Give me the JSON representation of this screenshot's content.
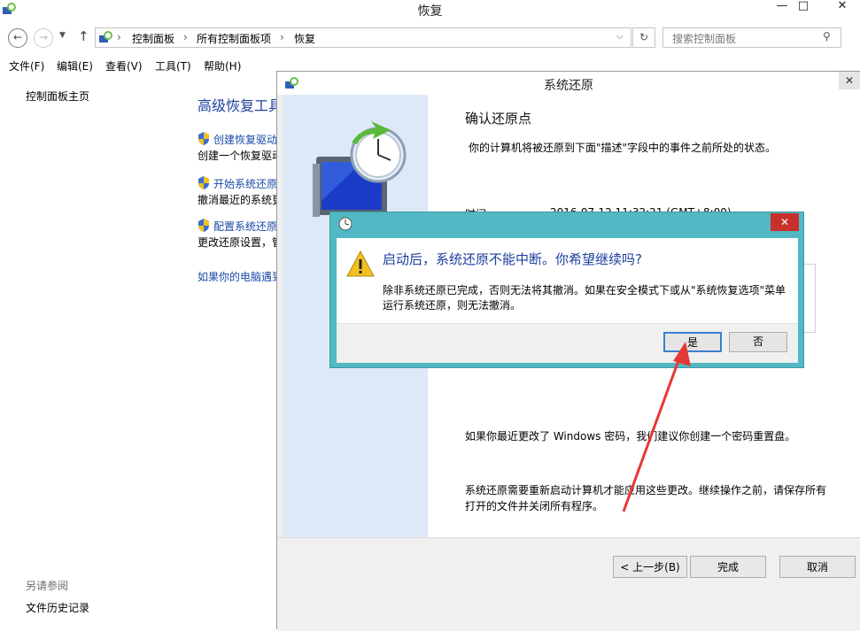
{
  "window": {
    "title": "恢复",
    "minimize": "—",
    "maximize": "□",
    "close": "✕"
  },
  "address": {
    "crumbs": [
      "控制面板",
      "所有控制面板项",
      "恢复"
    ],
    "search_placeholder": "搜索控制面板"
  },
  "menu": [
    "文件(F)",
    "编辑(E)",
    "查看(V)",
    "工具(T)",
    "帮助(H)"
  ],
  "left_pane": {
    "home_link": "控制面板主页",
    "see_also_label": "另请参阅",
    "file_history_link": "文件历史记录"
  },
  "main": {
    "heading": "高级恢复工具",
    "items": [
      {
        "link": "创建恢复驱动",
        "desc": "创建一个恢复驱动"
      },
      {
        "link": "开始系统还原",
        "desc": "撤消最近的系统更"
      },
      {
        "link": "配置系统还原",
        "desc": "更改还原设置，管"
      }
    ],
    "bottom_link": "如果你的电脑遇到"
  },
  "wizard": {
    "title": "系统还原",
    "heading": "确认还原点",
    "desc": "你的计算机将被还原到下面\"描述\"字段中的事件之前所处的状态。",
    "time_label": "时间:",
    "time_value": "2016-07-12 11:32:21 (GMT+8:00)",
    "password_note": "如果你最近更改了 Windows 密码，我们建议你创建一个密码重置盘。",
    "restart_note_1": "系统还原需要重新启动计算机才能应用这些更改。继续操作之前，请保存所有",
    "restart_note_2": "打开的文件并关闭所有程序。",
    "back_button": "< 上一步(B)",
    "finish_button": "完成",
    "cancel_button": "取消"
  },
  "dialog": {
    "question": "启动后，系统还原不能中断。你希望继续吗?",
    "detail_1": "除非系统还原已完成，否则无法将其撤消。如果在安全模式下或从\"系统恢复选项\"菜单",
    "detail_2": "运行系统还原，则无法撤消。",
    "yes_button": "是",
    "no_button": "否",
    "close": "✕"
  },
  "colors": {
    "dialog_frame": "#51b8c4",
    "dialog_close": "#c9302c",
    "link": "#1a4aa8",
    "heading_blue": "#1c3f9c",
    "annotation_arrow": "#e53935"
  }
}
